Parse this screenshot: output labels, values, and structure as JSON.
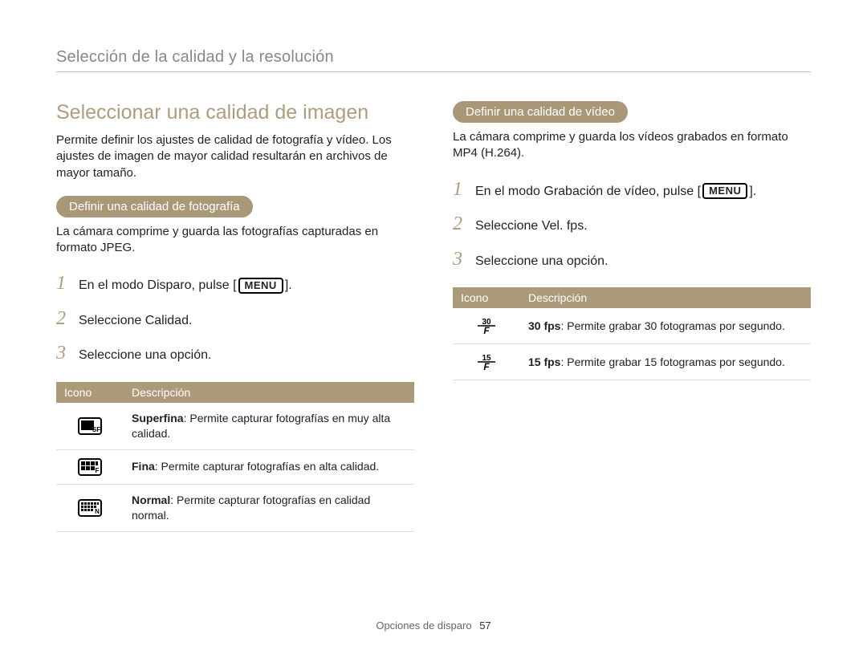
{
  "header": {
    "breadcrumb": "Selección de la calidad y la resolución"
  },
  "left": {
    "title": "Seleccionar una calidad de imagen",
    "intro": "Permite definir los ajustes de calidad de fotografía y vídeo. Los ajustes de imagen de mayor calidad resultarán en archivos de mayor tamaño.",
    "subheading": "Definir una calidad de fotografía",
    "subintro": "La cámara comprime y guarda las fotografías capturadas en formato JPEG.",
    "steps": {
      "s1_pre": "En el modo Disparo, pulse [",
      "menu": "MENU",
      "s1_post": "].",
      "s2_pre": "Seleccione ",
      "s2_bold": "Calidad",
      "s2_post": ".",
      "s3": "Seleccione una opción."
    },
    "table": {
      "h1": "Icono",
      "h2": "Descripción",
      "rows": [
        {
          "icon": "sf",
          "bold": "Superfina",
          "text": ": Permite capturar fotografías en muy alta calidad."
        },
        {
          "icon": "f",
          "bold": "Fina",
          "text": ": Permite capturar fotografías en alta calidad."
        },
        {
          "icon": "n",
          "bold": "Normal",
          "text": ": Permite capturar fotografías en calidad normal."
        }
      ]
    }
  },
  "right": {
    "subheading": "Definir una calidad de vídeo",
    "subintro": "La cámara comprime y guarda los vídeos grabados en formato MP4 (H.264).",
    "steps": {
      "s1_pre": "En el modo Grabación de vídeo, pulse [",
      "menu": "MENU",
      "s1_post": "].",
      "s2_pre": "Seleccione ",
      "s2_bold": "Vel. fps",
      "s2_post": ".",
      "s3": "Seleccione una opción."
    },
    "table": {
      "h1": "Icono",
      "h2": "Descripción",
      "rows": [
        {
          "icon": "30f",
          "bold": "30 fps",
          "text": ": Permite grabar 30 fotogramas por segundo."
        },
        {
          "icon": "15f",
          "bold": "15 fps",
          "text": ": Permite grabar 15 fotogramas por segundo."
        }
      ]
    }
  },
  "footer": {
    "section": "Opciones de disparo",
    "page": "57"
  }
}
